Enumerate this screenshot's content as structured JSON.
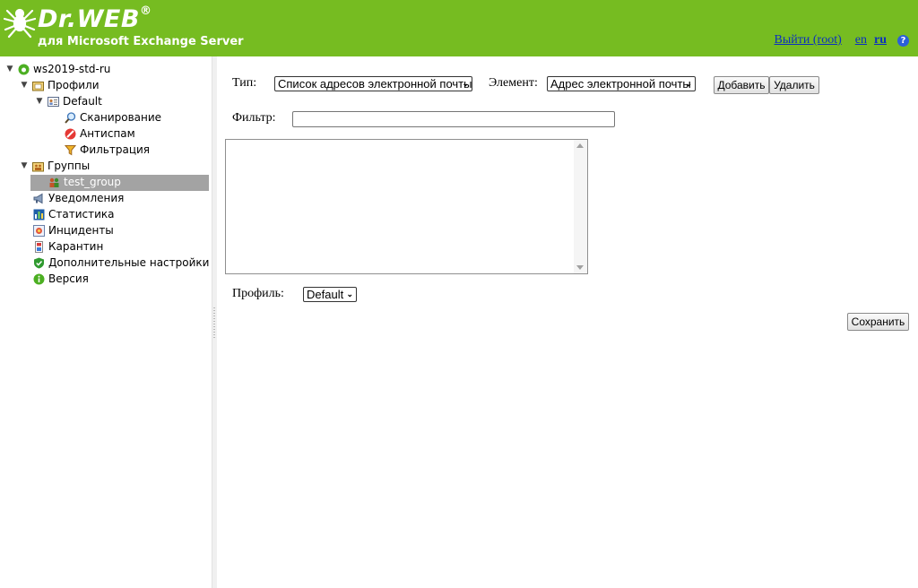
{
  "header": {
    "brand": "Dr.WEB",
    "brand_mark": "®",
    "subtitle": "для Microsoft Exchange Server",
    "logout": "Выйти (root)",
    "lang_en": "en",
    "lang_ru": "ru",
    "help": "?"
  },
  "sidebar": {
    "root": "ws2019-std-ru",
    "profiles": "Профили",
    "default_profile": "Default",
    "scanning": "Сканирование",
    "antispam": "Антиспам",
    "filtering": "Фильтрация",
    "groups": "Группы",
    "test_group": "test_group",
    "notifications": "Уведомления",
    "statistics": "Статистика",
    "incidents": "Инциденты",
    "quarantine": "Карантин",
    "advanced": "Дополнительные настройки",
    "version": "Версия"
  },
  "main": {
    "type_label": "Тип:",
    "type_value": "Список адресов электронной почты",
    "element_label": "Элемент:",
    "element_value": "Адрес электронной почты",
    "add_button": "Добавить",
    "delete_button": "Удалить",
    "filter_label": "Фильтр:",
    "filter_value": "",
    "profile_label": "Профиль:",
    "profile_value": "Default",
    "save_button": "Сохранить"
  },
  "colors": {
    "header_green": "#76bc21",
    "selected_row": "#a3a3a3",
    "link_blue": "#0b2fbf"
  }
}
